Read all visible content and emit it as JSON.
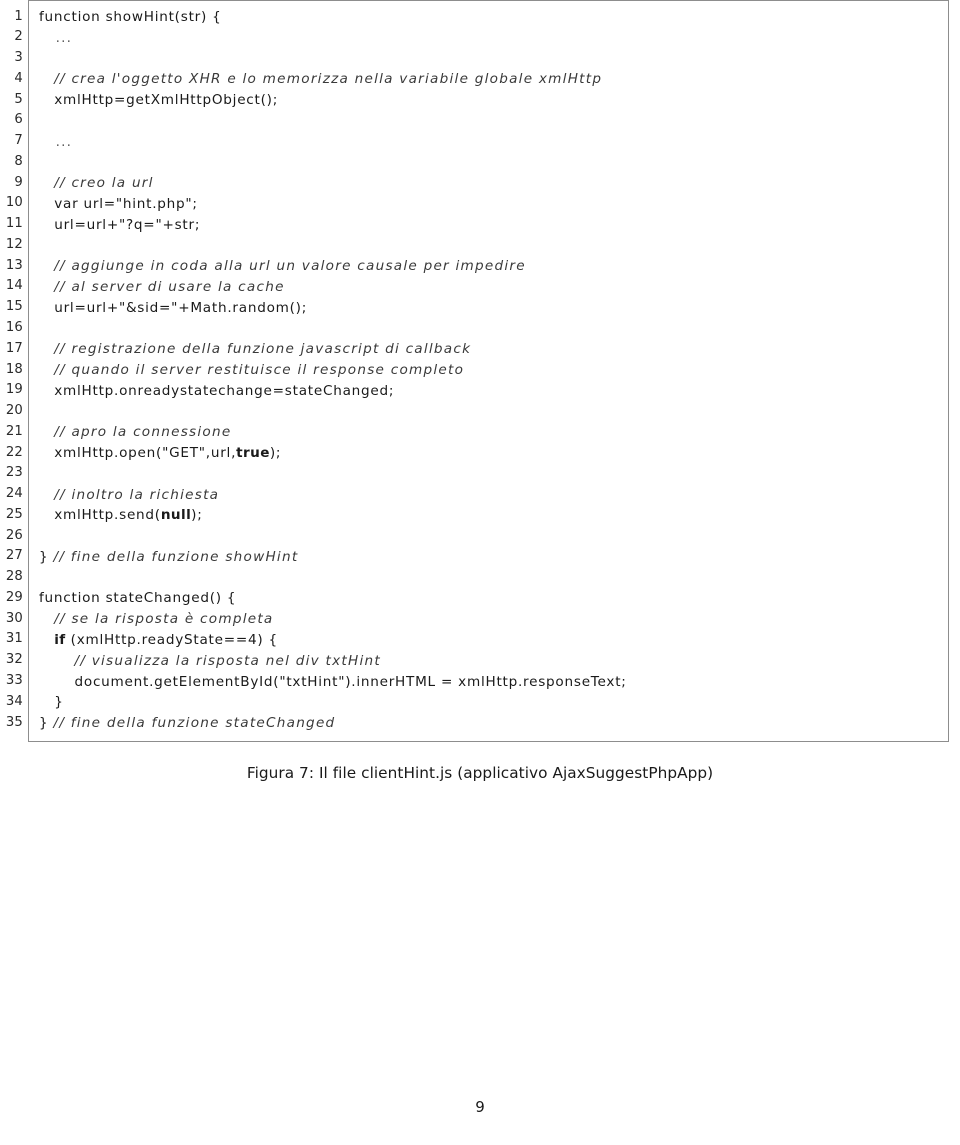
{
  "figure": {
    "caption": "Figura 7: Il file clientHint.js (applicativo AjaxSuggestPhpApp)",
    "language": "javascript",
    "first_line_number": 1,
    "last_line_number": 35,
    "line_numbers": [
      "1",
      "2",
      "3",
      "4",
      "5",
      "6",
      "7",
      "8",
      "9",
      "10",
      "11",
      "12",
      "13",
      "14",
      "15",
      "16",
      "17",
      "18",
      "19",
      "20",
      "21",
      "22",
      "23",
      "24",
      "25",
      "26",
      "27",
      "28",
      "29",
      "30",
      "31",
      "32",
      "33",
      "34",
      "35"
    ],
    "code_lines": [
      "function showHint(str) {",
      "   ...",
      "",
      "   // crea l'oggetto XHR e lo memorizza nella variabile globale xmlHttp",
      "   xmlHttp=getXmlHttpObject();",
      "",
      "   ...",
      "",
      "   // creo la url",
      "   var url=\"hint.php\";",
      "   url=url+\"?q=\"+str;",
      "",
      "   // aggiunge in coda alla url un valore causale per impedire",
      "   // al server di usare la cache",
      "   url=url+\"&sid=\"+Math.random();",
      "",
      "   // registrazione della funzione javascript di callback",
      "   // quando il server restituisce il response completo",
      "   xmlHttp.onreadystatechange=stateChanged;",
      "",
      "   // apro la connessione",
      "   xmlHttp.open(\"GET\",url,true);",
      "",
      "   // inoltro la richiesta",
      "   xmlHttp.send(null);",
      "",
      "} // fine della funzione showHint",
      "",
      "function stateChanged() {",
      "   // se la risposta è completa",
      "   if (xmlHttp.readyState==4) {",
      "       // visualizza la risposta nel div txtHint",
      "       document.getElementById(\"txtHint\").innerHTML = xmlHttp.responseText;",
      "   }",
      "} // fine della funzione stateChanged"
    ]
  },
  "footer": {
    "page_number": "9"
  },
  "colors": {
    "frame_border": "#8d8d8d",
    "text": "#1a1a1a",
    "comment": "#3a3a3a",
    "background": "#ffffff"
  }
}
